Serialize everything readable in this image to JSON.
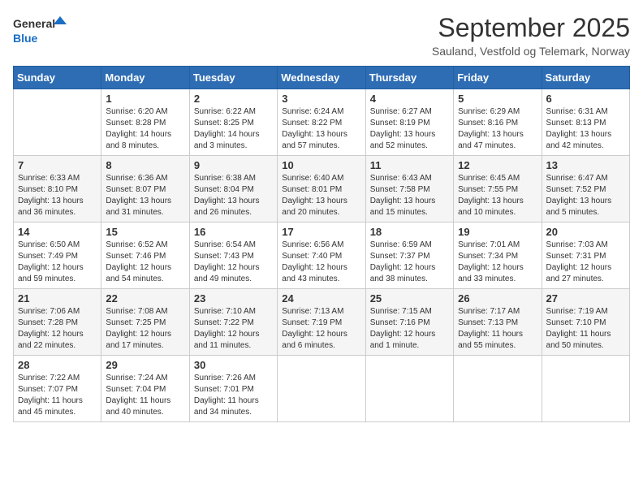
{
  "logo": {
    "general": "General",
    "blue": "Blue"
  },
  "header": {
    "month": "September 2025",
    "location": "Sauland, Vestfold og Telemark, Norway"
  },
  "weekdays": [
    "Sunday",
    "Monday",
    "Tuesday",
    "Wednesday",
    "Thursday",
    "Friday",
    "Saturday"
  ],
  "weeks": [
    [
      {
        "day": "",
        "info": ""
      },
      {
        "day": "1",
        "info": "Sunrise: 6:20 AM\nSunset: 8:28 PM\nDaylight: 14 hours\nand 8 minutes."
      },
      {
        "day": "2",
        "info": "Sunrise: 6:22 AM\nSunset: 8:25 PM\nDaylight: 14 hours\nand 3 minutes."
      },
      {
        "day": "3",
        "info": "Sunrise: 6:24 AM\nSunset: 8:22 PM\nDaylight: 13 hours\nand 57 minutes."
      },
      {
        "day": "4",
        "info": "Sunrise: 6:27 AM\nSunset: 8:19 PM\nDaylight: 13 hours\nand 52 minutes."
      },
      {
        "day": "5",
        "info": "Sunrise: 6:29 AM\nSunset: 8:16 PM\nDaylight: 13 hours\nand 47 minutes."
      },
      {
        "day": "6",
        "info": "Sunrise: 6:31 AM\nSunset: 8:13 PM\nDaylight: 13 hours\nand 42 minutes."
      }
    ],
    [
      {
        "day": "7",
        "info": "Sunrise: 6:33 AM\nSunset: 8:10 PM\nDaylight: 13 hours\nand 36 minutes."
      },
      {
        "day": "8",
        "info": "Sunrise: 6:36 AM\nSunset: 8:07 PM\nDaylight: 13 hours\nand 31 minutes."
      },
      {
        "day": "9",
        "info": "Sunrise: 6:38 AM\nSunset: 8:04 PM\nDaylight: 13 hours\nand 26 minutes."
      },
      {
        "day": "10",
        "info": "Sunrise: 6:40 AM\nSunset: 8:01 PM\nDaylight: 13 hours\nand 20 minutes."
      },
      {
        "day": "11",
        "info": "Sunrise: 6:43 AM\nSunset: 7:58 PM\nDaylight: 13 hours\nand 15 minutes."
      },
      {
        "day": "12",
        "info": "Sunrise: 6:45 AM\nSunset: 7:55 PM\nDaylight: 13 hours\nand 10 minutes."
      },
      {
        "day": "13",
        "info": "Sunrise: 6:47 AM\nSunset: 7:52 PM\nDaylight: 13 hours\nand 5 minutes."
      }
    ],
    [
      {
        "day": "14",
        "info": "Sunrise: 6:50 AM\nSunset: 7:49 PM\nDaylight: 12 hours\nand 59 minutes."
      },
      {
        "day": "15",
        "info": "Sunrise: 6:52 AM\nSunset: 7:46 PM\nDaylight: 12 hours\nand 54 minutes."
      },
      {
        "day": "16",
        "info": "Sunrise: 6:54 AM\nSunset: 7:43 PM\nDaylight: 12 hours\nand 49 minutes."
      },
      {
        "day": "17",
        "info": "Sunrise: 6:56 AM\nSunset: 7:40 PM\nDaylight: 12 hours\nand 43 minutes."
      },
      {
        "day": "18",
        "info": "Sunrise: 6:59 AM\nSunset: 7:37 PM\nDaylight: 12 hours\nand 38 minutes."
      },
      {
        "day": "19",
        "info": "Sunrise: 7:01 AM\nSunset: 7:34 PM\nDaylight: 12 hours\nand 33 minutes."
      },
      {
        "day": "20",
        "info": "Sunrise: 7:03 AM\nSunset: 7:31 PM\nDaylight: 12 hours\nand 27 minutes."
      }
    ],
    [
      {
        "day": "21",
        "info": "Sunrise: 7:06 AM\nSunset: 7:28 PM\nDaylight: 12 hours\nand 22 minutes."
      },
      {
        "day": "22",
        "info": "Sunrise: 7:08 AM\nSunset: 7:25 PM\nDaylight: 12 hours\nand 17 minutes."
      },
      {
        "day": "23",
        "info": "Sunrise: 7:10 AM\nSunset: 7:22 PM\nDaylight: 12 hours\nand 11 minutes."
      },
      {
        "day": "24",
        "info": "Sunrise: 7:13 AM\nSunset: 7:19 PM\nDaylight: 12 hours\nand 6 minutes."
      },
      {
        "day": "25",
        "info": "Sunrise: 7:15 AM\nSunset: 7:16 PM\nDaylight: 12 hours\nand 1 minute."
      },
      {
        "day": "26",
        "info": "Sunrise: 7:17 AM\nSunset: 7:13 PM\nDaylight: 11 hours\nand 55 minutes."
      },
      {
        "day": "27",
        "info": "Sunrise: 7:19 AM\nSunset: 7:10 PM\nDaylight: 11 hours\nand 50 minutes."
      }
    ],
    [
      {
        "day": "28",
        "info": "Sunrise: 7:22 AM\nSunset: 7:07 PM\nDaylight: 11 hours\nand 45 minutes."
      },
      {
        "day": "29",
        "info": "Sunrise: 7:24 AM\nSunset: 7:04 PM\nDaylight: 11 hours\nand 40 minutes."
      },
      {
        "day": "30",
        "info": "Sunrise: 7:26 AM\nSunset: 7:01 PM\nDaylight: 11 hours\nand 34 minutes."
      },
      {
        "day": "",
        "info": ""
      },
      {
        "day": "",
        "info": ""
      },
      {
        "day": "",
        "info": ""
      },
      {
        "day": "",
        "info": ""
      }
    ]
  ]
}
